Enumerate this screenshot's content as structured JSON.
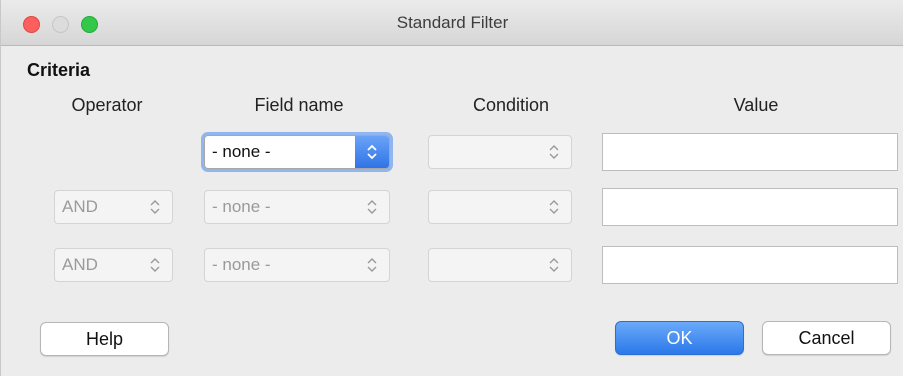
{
  "window": {
    "title": "Standard Filter"
  },
  "criteria": {
    "label": "Criteria",
    "headers": {
      "operator": "Operator",
      "field_name": "Field name",
      "condition": "Condition",
      "value": "Value"
    },
    "rows": [
      {
        "operator": "",
        "field": "- none -",
        "condition": "",
        "value": ""
      },
      {
        "operator": "AND",
        "field": "- none -",
        "condition": "",
        "value": ""
      },
      {
        "operator": "AND",
        "field": "- none -",
        "condition": "",
        "value": ""
      }
    ]
  },
  "buttons": {
    "help": "Help",
    "ok": "OK",
    "cancel": "Cancel"
  },
  "icons": {
    "dropdown": "up-down-chevron-icon"
  },
  "colors": {
    "accent": "#2f74e7",
    "close": "#fc605c",
    "maximize": "#34c84a"
  }
}
